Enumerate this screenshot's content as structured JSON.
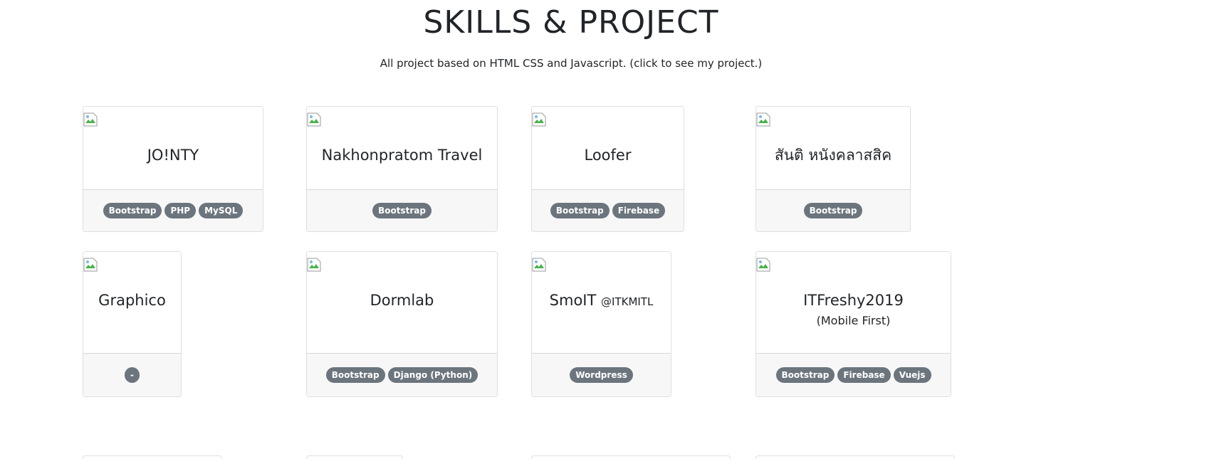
{
  "header": {
    "title": "SKILLS & PROJECT",
    "subtitle": "All project based on HTML CSS and Javascript. (click to see my project.)"
  },
  "colors": {
    "badge": "#6c757d",
    "footer_bg": "#f7f7f7",
    "text": "#212529"
  },
  "projects": [
    {
      "title": "JO!NTY",
      "tags": [
        "Bootstrap",
        "PHP",
        "MySQL"
      ]
    },
    {
      "title": "Nakhonpratom Travel",
      "tags": [
        "Bootstrap"
      ]
    },
    {
      "title": "Loofer",
      "tags": [
        "Bootstrap",
        "Firebase"
      ]
    },
    {
      "title": "สันติ หนังคลาสสิค",
      "tags": [
        "Bootstrap"
      ]
    },
    {
      "title": "Graphico",
      "tags": [
        "-"
      ]
    },
    {
      "title": "Dormlab",
      "tags": [
        "Bootstrap",
        "Django (Python)"
      ]
    },
    {
      "title": "SmoIT",
      "title_small": "@ITKMITL",
      "tags": [
        "Wordpress"
      ]
    },
    {
      "title": "ITFreshy2019",
      "subtitle": "(Mobile First)",
      "tags": [
        "Bootstrap",
        "Firebase",
        "Vuejs"
      ]
    }
  ]
}
